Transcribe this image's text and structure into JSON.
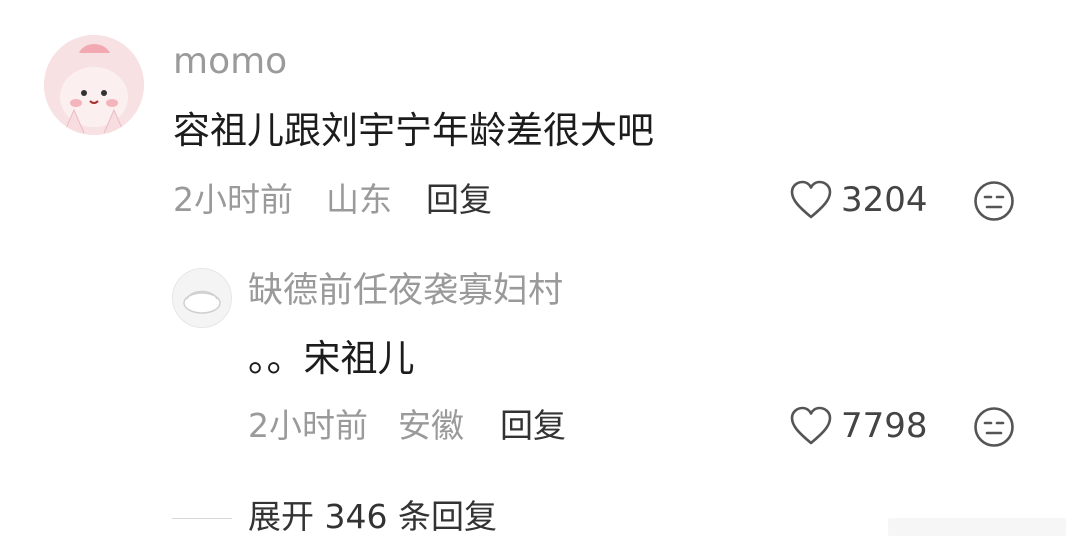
{
  "comment": {
    "username": "momo",
    "text": "容祖儿跟刘宇宁年龄差很大吧",
    "time": "2小时前",
    "location": "山东",
    "reply_label": "回复",
    "likes": "3204"
  },
  "reply": {
    "username": "缺德前任夜袭寡妇村",
    "text": "。。宋祖儿",
    "time": "2小时前",
    "location": "安徽",
    "reply_label": "回复",
    "likes": "7798"
  },
  "expand": {
    "label": "展开 346 条回复"
  },
  "icons": {
    "like": "heart-outline-icon",
    "dislike": "meh-face-icon"
  },
  "colors": {
    "text_primary": "#1c1c1c",
    "text_secondary": "#9a9a9a",
    "avatar_bg": "#f6dde0"
  }
}
